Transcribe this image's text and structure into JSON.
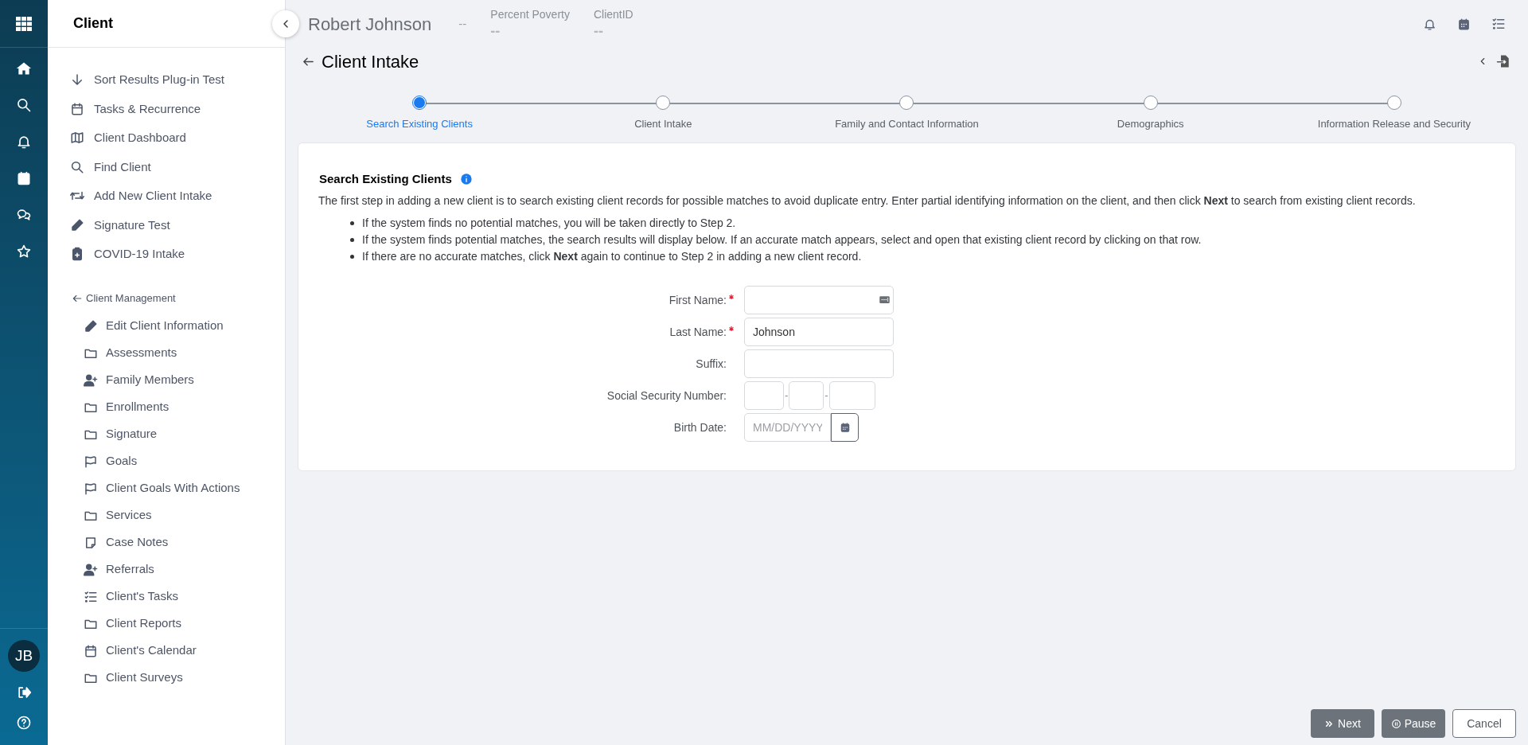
{
  "user": {
    "initials": "JB"
  },
  "sidebar": {
    "title": "Client",
    "items": [
      {
        "label": "Sort Results Plug-in Test"
      },
      {
        "label": "Tasks & Recurrence"
      },
      {
        "label": "Client Dashboard"
      },
      {
        "label": "Find Client"
      },
      {
        "label": "Add New Client Intake"
      },
      {
        "label": "Signature Test"
      },
      {
        "label": "COVID-19 Intake"
      }
    ],
    "section": {
      "label": "Client Management",
      "items": [
        {
          "label": "Edit Client Information"
        },
        {
          "label": "Assessments"
        },
        {
          "label": "Family Members"
        },
        {
          "label": "Enrollments"
        },
        {
          "label": "Signature"
        },
        {
          "label": "Goals"
        },
        {
          "label": "Client Goals With Actions"
        },
        {
          "label": "Services"
        },
        {
          "label": "Case Notes"
        },
        {
          "label": "Referrals"
        },
        {
          "label": "Client's Tasks"
        },
        {
          "label": "Client Reports"
        },
        {
          "label": "Client's Calendar"
        },
        {
          "label": "Client Surveys"
        }
      ]
    }
  },
  "header": {
    "client_name": "Robert Johnson",
    "name_suffix": "--",
    "stats": [
      {
        "label": "Percent Poverty",
        "value": "--"
      },
      {
        "label": "ClientID",
        "value": "--"
      }
    ]
  },
  "page": {
    "title": "Client Intake"
  },
  "steps": [
    {
      "label": "Search Existing Clients",
      "selected": true
    },
    {
      "label": "Client Intake",
      "selected": false
    },
    {
      "label": "Family and Contact Information",
      "selected": false
    },
    {
      "label": "Demographics",
      "selected": false
    },
    {
      "label": "Information Release and Security",
      "selected": false
    }
  ],
  "card": {
    "title": "Search Existing Clients",
    "intro": "The first step in adding a new client is to search existing client records for possible matches to avoid duplicate entry. Enter partial identifying information on the client, and then click **Next** to search from existing client records.",
    "bullets": [
      "If the system finds no potential matches, you will be taken directly to Step 2.",
      "If the system finds potential matches, the search results will display below. If an accurate match appears, select and open that existing client record by clicking on that row.",
      "If there are no accurate matches, click **Next** again to continue to Step 2 in adding a new client record."
    ],
    "fields": [
      {
        "kind": "text",
        "label": "First Name:",
        "required": true
      },
      {
        "kind": "text",
        "label": "Last Name:",
        "required": true,
        "value": "Johnson"
      },
      {
        "kind": "text",
        "label": "Suffix:",
        "required": false
      },
      {
        "kind": "ssn",
        "label": "Social Security Number:",
        "required": false,
        "separators": [
          "-",
          "-"
        ]
      },
      {
        "kind": "date",
        "label": "Birth Date:",
        "required": false,
        "placeholder": "MM/DD/YYYY"
      }
    ]
  },
  "buttons": [
    {
      "kind": "primary",
      "label": "Next"
    },
    {
      "kind": "pause",
      "label": "Pause"
    },
    {
      "kind": "outline",
      "label": "Cancel"
    }
  ]
}
